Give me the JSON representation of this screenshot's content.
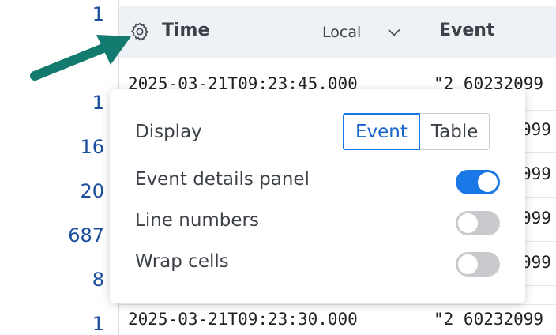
{
  "gutter": {
    "line_numbers": [
      "1",
      "1",
      "16",
      "20",
      "687",
      "8",
      "1"
    ]
  },
  "table": {
    "header": {
      "time_label": "Time",
      "timezone_value": "Local",
      "event_label": "Event"
    },
    "rows": [
      {
        "time": "2025-03-21T09:23:45.000",
        "event": "\"2 60232099"
      },
      {
        "time": "2025-03-21T09:23:30.000",
        "event": "\"2 60232099"
      }
    ],
    "hidden_fragment": "099"
  },
  "settings_popover": {
    "display_label": "Display",
    "display_options": [
      "Event",
      "Table"
    ],
    "display_selected": "Event",
    "event_details_label": "Event details panel",
    "event_details_on": true,
    "line_numbers_label": "Line numbers",
    "line_numbers_on": false,
    "wrap_cells_label": "Wrap cells",
    "wrap_cells_on": false
  },
  "colors": {
    "accent": "#1a78e6",
    "arrow": "#127a6e",
    "line_number_text": "#1b4f9c"
  },
  "icons": {
    "settings": "gear-icon",
    "dropdown": "chevron-down-icon",
    "annotation": "pointer-arrow-icon"
  }
}
